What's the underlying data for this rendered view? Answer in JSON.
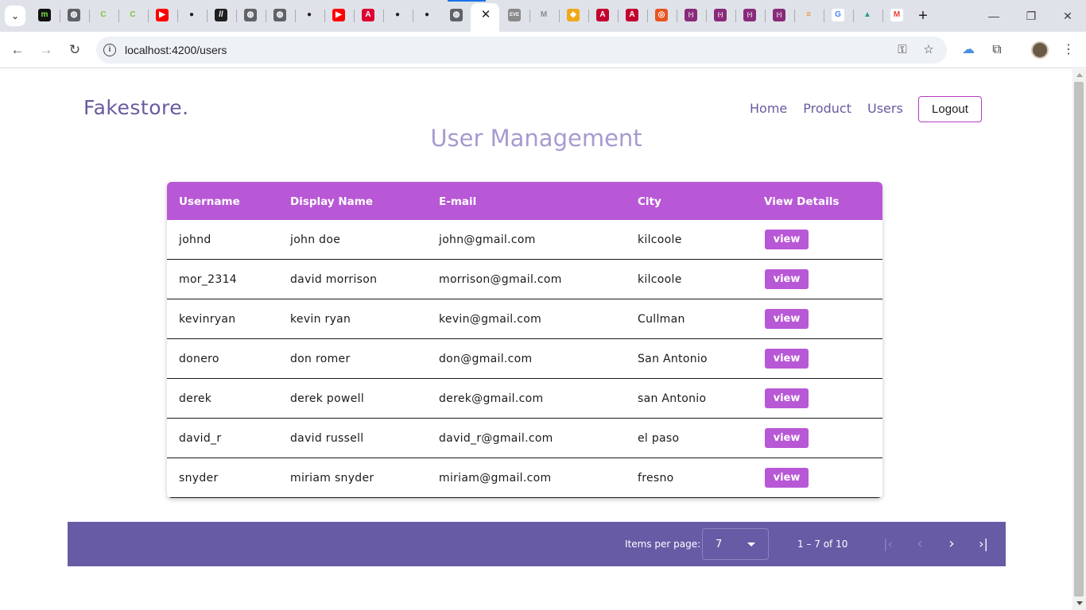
{
  "browser": {
    "tabs": [
      {
        "icon": "menu-tab-icon",
        "glyph": "m",
        "bg": "#101010",
        "fg": "#7fe34a"
      },
      {
        "icon": "globe-tab-icon",
        "glyph": "◍",
        "bg": "#5f6368",
        "fg": "#ffffff"
      },
      {
        "icon": "c-tab-icon",
        "glyph": "C",
        "bg": "#dfe3e9",
        "fg": "#7fc23a"
      },
      {
        "icon": "c-tab-icon",
        "glyph": "C",
        "bg": "#dfe3e9",
        "fg": "#7fc23a"
      },
      {
        "icon": "youtube-tab-icon",
        "glyph": "▶",
        "bg": "#ff0000",
        "fg": "#ffffff"
      },
      {
        "icon": "github-tab-icon",
        "glyph": "●",
        "bg": "#dfe3e9",
        "fg": "#1f1f1f"
      },
      {
        "icon": "dev-tab-icon",
        "glyph": "//",
        "bg": "#1f1f1f",
        "fg": "#ffffff"
      },
      {
        "icon": "globe-tab-icon",
        "glyph": "◍",
        "bg": "#5f6368",
        "fg": "#ffffff"
      },
      {
        "icon": "globe-tab-icon",
        "glyph": "◍",
        "bg": "#5f6368",
        "fg": "#ffffff"
      },
      {
        "icon": "github-tab-icon",
        "glyph": "●",
        "bg": "#dfe3e9",
        "fg": "#1f1f1f"
      },
      {
        "icon": "youtube-tab-icon",
        "glyph": "▶",
        "bg": "#ff0000",
        "fg": "#ffffff"
      },
      {
        "icon": "angular-tab-icon",
        "glyph": "A",
        "bg": "#dd0031",
        "fg": "#ffffff"
      },
      {
        "icon": "github-tab-icon",
        "glyph": "●",
        "bg": "#dfe3e9",
        "fg": "#1f1f1f"
      },
      {
        "icon": "github-tab-icon",
        "glyph": "●",
        "bg": "#dfe3e9",
        "fg": "#1f1f1f"
      },
      {
        "icon": "globe-tab-icon",
        "glyph": "◍",
        "bg": "#5f6368",
        "fg": "#ffffff"
      },
      {
        "icon": "eve-tab-icon",
        "glyph": "EVE",
        "bg": "#8a8a8a",
        "fg": "#ffffff"
      },
      {
        "icon": "gmail-tab-icon",
        "glyph": "M",
        "bg": "#dfe3e9",
        "fg": "#8a8a8a"
      },
      {
        "icon": "shield-tab-icon",
        "glyph": "◆",
        "bg": "#f0a81a",
        "fg": "#ffffff"
      },
      {
        "icon": "angular-tab-icon",
        "glyph": "A",
        "bg": "#c3002f",
        "fg": "#ffffff"
      },
      {
        "icon": "angular-tab-icon",
        "glyph": "A",
        "bg": "#c3002f",
        "fg": "#ffffff"
      },
      {
        "icon": "ubuntu-tab-icon",
        "glyph": "◎",
        "bg": "#e95420",
        "fg": "#ffffff"
      },
      {
        "icon": "bracket-tab-icon",
        "glyph": "[▪]",
        "bg": "#8a2a7a",
        "fg": "#ffffff"
      },
      {
        "icon": "bracket-tab-icon",
        "glyph": "[▪]",
        "bg": "#8a2a7a",
        "fg": "#ffffff"
      },
      {
        "icon": "bracket-tab-icon",
        "glyph": "[▪]",
        "bg": "#8a2a7a",
        "fg": "#ffffff"
      },
      {
        "icon": "bracket-tab-icon",
        "glyph": "[▪]",
        "bg": "#8a2a7a",
        "fg": "#ffffff"
      },
      {
        "icon": "stackoverflow-tab-icon",
        "glyph": "≡",
        "bg": "#dfe3e9",
        "fg": "#f48024"
      },
      {
        "icon": "google-tab-icon",
        "glyph": "G",
        "bg": "#ffffff",
        "fg": "#4285f4"
      },
      {
        "icon": "mountain-tab-icon",
        "glyph": "▲",
        "bg": "#dfe3e9",
        "fg": "#2a9d8f"
      },
      {
        "icon": "gmail-tab-icon",
        "glyph": "M",
        "bg": "#ffffff",
        "fg": "#ea4335"
      }
    ],
    "active_tab_close": "✕",
    "new_tab": "+",
    "window": {
      "minimize": "—",
      "restore": "❐",
      "close": "✕"
    },
    "nav": {
      "back": "←",
      "forward": "→",
      "reload": "↻"
    },
    "address": {
      "info": "i",
      "url": "localhost:4200/users"
    },
    "omnibox_icons": {
      "key": "⚿",
      "star": "☆"
    },
    "toolbar_icons": {
      "cloud": "☁",
      "extensions": "⧉",
      "menu": "⋮"
    }
  },
  "app": {
    "brand": "Fakestore.",
    "nav": [
      "Home",
      "Product",
      "Users"
    ],
    "logout": "Logout",
    "title": "User Management"
  },
  "table": {
    "headers": [
      "Username",
      "Display Name",
      "E-mail",
      "City",
      "View Details"
    ],
    "view_label": "view",
    "rows": [
      [
        "johnd",
        "john doe",
        "john@gmail.com",
        "kilcoole"
      ],
      [
        "mor_2314",
        "david morrison",
        "morrison@gmail.com",
        "kilcoole"
      ],
      [
        "kevinryan",
        "kevin ryan",
        "kevin@gmail.com",
        "Cullman"
      ],
      [
        "donero",
        "don romer",
        "don@gmail.com",
        "San Antonio"
      ],
      [
        "derek",
        "derek powell",
        "derek@gmail.com",
        "san Antonio"
      ],
      [
        "david_r",
        "david russell",
        "david_r@gmail.com",
        "el paso"
      ],
      [
        "snyder",
        "miriam snyder",
        "miriam@gmail.com",
        "fresno"
      ]
    ]
  },
  "paginator": {
    "items_per_page_label": "Items per page:",
    "page_size": "7",
    "range": "1 – 7 of 10",
    "first": "|‹",
    "prev": "‹",
    "next": "›",
    "last": "›|"
  },
  "colors": {
    "accent": "#b858d6",
    "paginator_bg": "#675ba6",
    "brand_text": "#6a5aa0",
    "title_text": "#a89ad0"
  }
}
